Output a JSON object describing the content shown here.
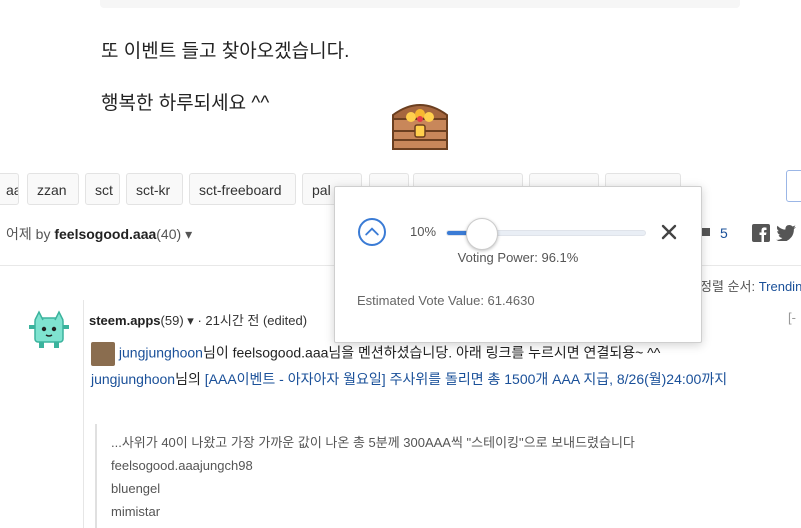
{
  "post": {
    "line1": "또 이벤트 들고 찾아오겠습니다.",
    "line2": "행복한 하루되세요 ^^",
    "image_icon": "treasure-chest-icon"
  },
  "tags": [
    "aa",
    "zzan",
    "sct",
    "sct-kr",
    "sct-freeboard",
    "pal",
    "",
    "",
    "",
    ""
  ],
  "meta": {
    "time": "어제",
    "by": "by",
    "author": "feelsogood.aaa",
    "reputation": "(40)",
    "comment_count": "5",
    "sort_label": "정렬 순서:",
    "sort_value": "Trending"
  },
  "comment": {
    "author": "steem.apps",
    "reputation": "(59)",
    "time": "· 21시간 전 (edited)",
    "user1": "jungjunghoon",
    "text1": "님이 feelsogood.aaa님을 멘션하셨습니당. 아래 링크를 누르시면 연결되용~ ^^",
    "user2": "jungjunghoon",
    "text2a": "님의",
    "link": "[AAA이벤트 - 아자아자 월요일] 주사위를 돌리면 총 1500개 AAA 지급, 8/26(월)24:00까지",
    "quote": [
      "...사위가 40이 나왔고 가장 가까운 값이 나온 총 5분께 300AAA씩 \"스테이킹\"으로 보내드렸습니다",
      "feelsogood.aaajungch98",
      "bluengel",
      "mimistar"
    ],
    "collapse": "[-"
  },
  "vote_popup": {
    "percent_label": "10%",
    "percent": 0.1,
    "voting_power": "Voting Power: 96.1%",
    "estimated": "Estimated Vote Value: 61.4630"
  },
  "colors": {
    "accent": "#3a7bd5",
    "link": "#1a5099"
  }
}
